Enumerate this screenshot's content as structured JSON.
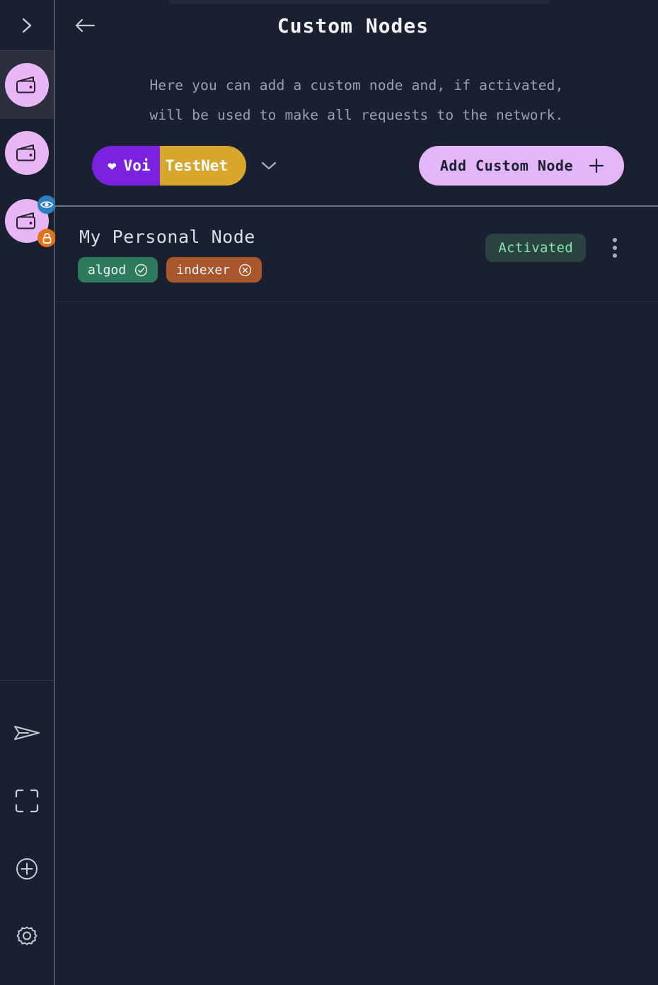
{
  "app": {
    "background": "#1b2030",
    "accent_purple": "#7a22e0",
    "accent_gold": "#d7a72d",
    "accent_lavender": "#e3b7f7"
  },
  "sidebar": {
    "expand_button": {
      "name": "expand-sidebar",
      "icon": "chevron-right-icon"
    },
    "wallets": [
      {
        "label": "Wallet 1",
        "icon": "wallet-icon",
        "selected": true,
        "badges": []
      },
      {
        "label": "Wallet 2",
        "icon": "wallet-icon",
        "selected": false,
        "badges": []
      },
      {
        "label": "Wallet 3",
        "icon": "wallet-icon",
        "selected": false,
        "badges": [
          {
            "name": "watch-account-badge",
            "icon": "eye-icon",
            "color": "#2b80c4"
          },
          {
            "name": "locked-account-badge",
            "icon": "lock-icon",
            "color": "#e2721b"
          }
        ]
      }
    ],
    "actions": [
      {
        "name": "send-button",
        "icon": "send-icon"
      },
      {
        "name": "scan-qr-button",
        "icon": "scan-frame-icon"
      },
      {
        "name": "add-account-button",
        "icon": "plus-circle-icon"
      },
      {
        "name": "settings-button",
        "icon": "gear-icon"
      }
    ]
  },
  "header": {
    "back_icon": "arrow-left-icon",
    "title": "Custom Nodes"
  },
  "main": {
    "description": "Here you can add a custom node and, if activated,\nwill be used to make all requests to the network.",
    "network_selector": {
      "heart_icon": "heart-icon",
      "chain": "Voi",
      "network": "TestNet",
      "chevron_icon": "chevron-down-icon"
    },
    "add_node_button": {
      "label": "Add Custom Node",
      "plus_icon": "plus-icon"
    }
  },
  "nodes": [
    {
      "name": "My Personal Node",
      "status": "Activated",
      "services": [
        {
          "label": "algod",
          "state": "ok",
          "icon": "check-circle-icon",
          "color": "#2d7a5c"
        },
        {
          "label": "indexer",
          "state": "error",
          "icon": "x-circle-icon",
          "color": "#a8562b"
        }
      ],
      "menu_icon": "kebab-menu-icon"
    }
  ]
}
